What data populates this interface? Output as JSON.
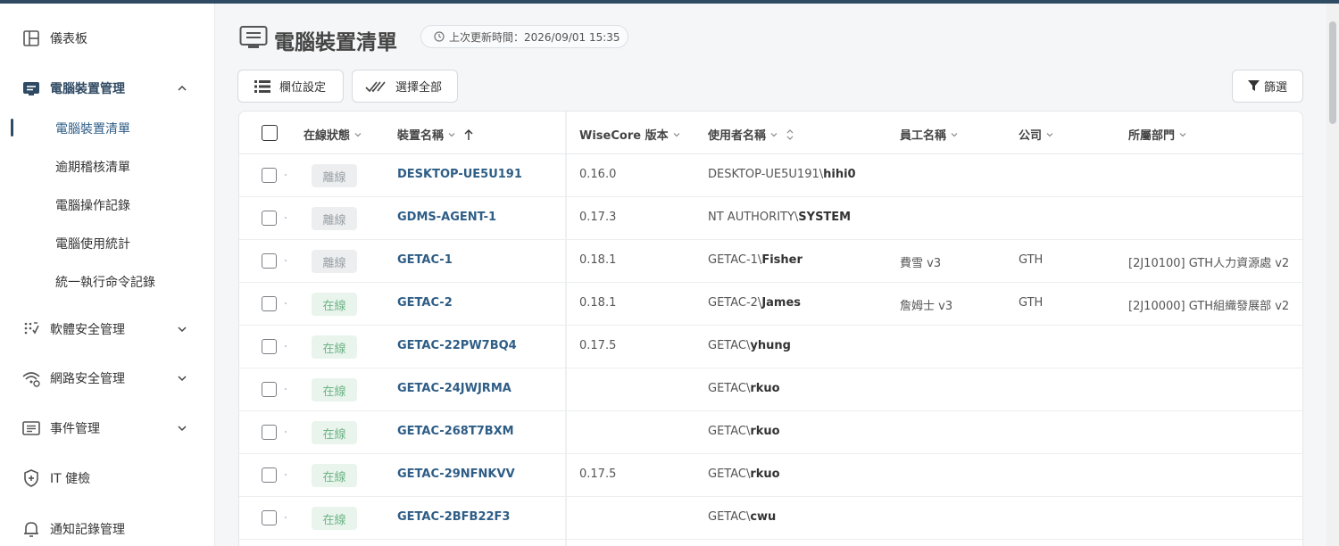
{
  "sidebar": {
    "items": [
      {
        "label": "儀表板"
      },
      {
        "label": "電腦裝置管理"
      },
      {
        "label": "軟體安全管理"
      },
      {
        "label": "網路安全管理"
      },
      {
        "label": "事件管理"
      },
      {
        "label": "IT 健檢"
      },
      {
        "label": "通知記錄管理"
      }
    ],
    "sub_items": [
      {
        "label": "電腦裝置清單"
      },
      {
        "label": "逾期稽核清單"
      },
      {
        "label": "電腦操作記錄"
      },
      {
        "label": "電腦使用統計"
      },
      {
        "label": "統一執行命令記錄"
      }
    ]
  },
  "page": {
    "title": "電腦裝置清單",
    "updated": "上次更新時間：2026/09/01 15:35"
  },
  "toolbar": {
    "column_settings": "欄位設定",
    "select_all": "選擇全部",
    "filter": "篩選"
  },
  "table": {
    "headers": {
      "status": "在線狀態",
      "device": "裝置名稱",
      "wisecore": "WiseCore 版本",
      "user": "使用者名稱",
      "employee": "員工名稱",
      "company": "公司",
      "dept": "所屬部門"
    },
    "rows": [
      {
        "status": "離線",
        "device": "DESKTOP-UE5U191",
        "version": "0.16.0",
        "user_prefix": "DESKTOP-UE5U191\\",
        "user_name": "hihi0",
        "employee": "",
        "company": "",
        "dept": ""
      },
      {
        "status": "離線",
        "device": "GDMS-AGENT-1",
        "version": "0.17.3",
        "user_prefix": "NT AUTHORITY\\",
        "user_name": "SYSTEM",
        "employee": "",
        "company": "",
        "dept": ""
      },
      {
        "status": "離線",
        "device": "GETAC-1",
        "version": "0.18.1",
        "user_prefix": "GETAC-1\\",
        "user_name": "Fisher",
        "employee": "費雪 v3",
        "company": "GTH",
        "dept": "[2J10100] GTH人力資源處 v2"
      },
      {
        "status": "在線",
        "device": "GETAC-2",
        "version": "0.18.1",
        "user_prefix": "GETAC-2\\",
        "user_name": "James",
        "employee": "詹姆士 v3",
        "company": "GTH",
        "dept": "[2J10000] GTH組織發展部 v2"
      },
      {
        "status": "在線",
        "device": "GETAC-22PW7BQ4",
        "version": "0.17.5",
        "user_prefix": "GETAC\\",
        "user_name": "yhung",
        "employee": "",
        "company": "",
        "dept": ""
      },
      {
        "status": "在線",
        "device": "GETAC-24JWJRMA",
        "version": "",
        "user_prefix": "GETAC\\",
        "user_name": "rkuo",
        "employee": "",
        "company": "",
        "dept": ""
      },
      {
        "status": "在線",
        "device": "GETAC-268T7BXM",
        "version": "",
        "user_prefix": "GETAC\\",
        "user_name": "rkuo",
        "employee": "",
        "company": "",
        "dept": ""
      },
      {
        "status": "在線",
        "device": "GETAC-29NFNKVV",
        "version": "0.17.5",
        "user_prefix": "GETAC\\",
        "user_name": "rkuo",
        "employee": "",
        "company": "",
        "dept": ""
      },
      {
        "status": "在線",
        "device": "GETAC-2BFB22F3",
        "version": "",
        "user_prefix": "GETAC\\",
        "user_name": "cwu",
        "employee": "",
        "company": "",
        "dept": ""
      }
    ]
  },
  "colors": {
    "primary": "#2f4a63",
    "link": "#2e5d86",
    "online_bg": "#e8f4ec",
    "online_text": "#6fb487",
    "offline_bg": "#eceeef",
    "offline_text": "#9aa0a6"
  }
}
